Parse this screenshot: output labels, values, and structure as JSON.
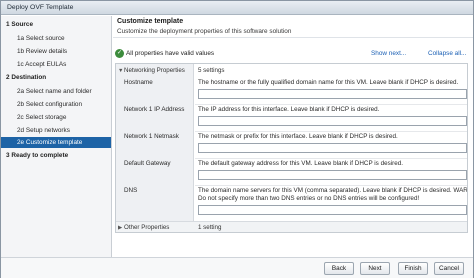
{
  "window": {
    "title": "Deploy OVF Template"
  },
  "sidebar": {
    "items": [
      {
        "label": "1  Source",
        "kind": "section"
      },
      {
        "label": "1a  Select source",
        "kind": "sub"
      },
      {
        "label": "1b  Review details",
        "kind": "sub"
      },
      {
        "label": "1c  Accept EULAs",
        "kind": "sub"
      },
      {
        "label": "2  Destination",
        "kind": "section"
      },
      {
        "label": "2a  Select name and folder",
        "kind": "sub"
      },
      {
        "label": "2b  Select configuration",
        "kind": "sub"
      },
      {
        "label": "2c  Select storage",
        "kind": "sub"
      },
      {
        "label": "2d  Setup networks",
        "kind": "sub"
      },
      {
        "label": "2e  Customize template",
        "kind": "sub",
        "active": true
      },
      {
        "label": "3  Ready to complete",
        "kind": "section"
      }
    ]
  },
  "header": {
    "title": "Customize template",
    "subtitle": "Customize the deployment properties of this software solution"
  },
  "status": {
    "valid_text": "All properties have valid values",
    "show_next": "Show next...",
    "collapse_all": "Collapse all..."
  },
  "properties": {
    "group_label": "Networking Properties",
    "group_count": "5 settings",
    "rows": [
      {
        "label": "Hostname",
        "desc": "The hostname or the fully qualified domain name for this VM. Leave blank if DHCP is desired.",
        "value": ""
      },
      {
        "label": "Network 1 IP Address",
        "desc": "The IP address for this interface. Leave blank if DHCP is desired.",
        "value": ""
      },
      {
        "label": "Network 1 Netmask",
        "desc": "The netmask or prefix for this interface. Leave blank if DHCP is desired.",
        "value": ""
      },
      {
        "label": "Default Gateway",
        "desc": "The default gateway address for this VM. Leave blank if DHCP is desired.",
        "value": ""
      },
      {
        "label": "DNS",
        "desc": "The domain name servers for this VM (comma separated). Leave blank if DHCP is desired. WARNING",
        "desc2": "Do not specify more than two DNS entries or no DNS entries will be configured!",
        "value": ""
      }
    ],
    "other_label": "Other Properties",
    "other_count": "1 setting"
  },
  "footer": {
    "back": "Back",
    "next": "Next",
    "finish": "Finish",
    "cancel": "Cancel"
  },
  "colors": {
    "accent": "#1d63a6",
    "link": "#1a5fb4",
    "ok": "#3d8c3d"
  }
}
